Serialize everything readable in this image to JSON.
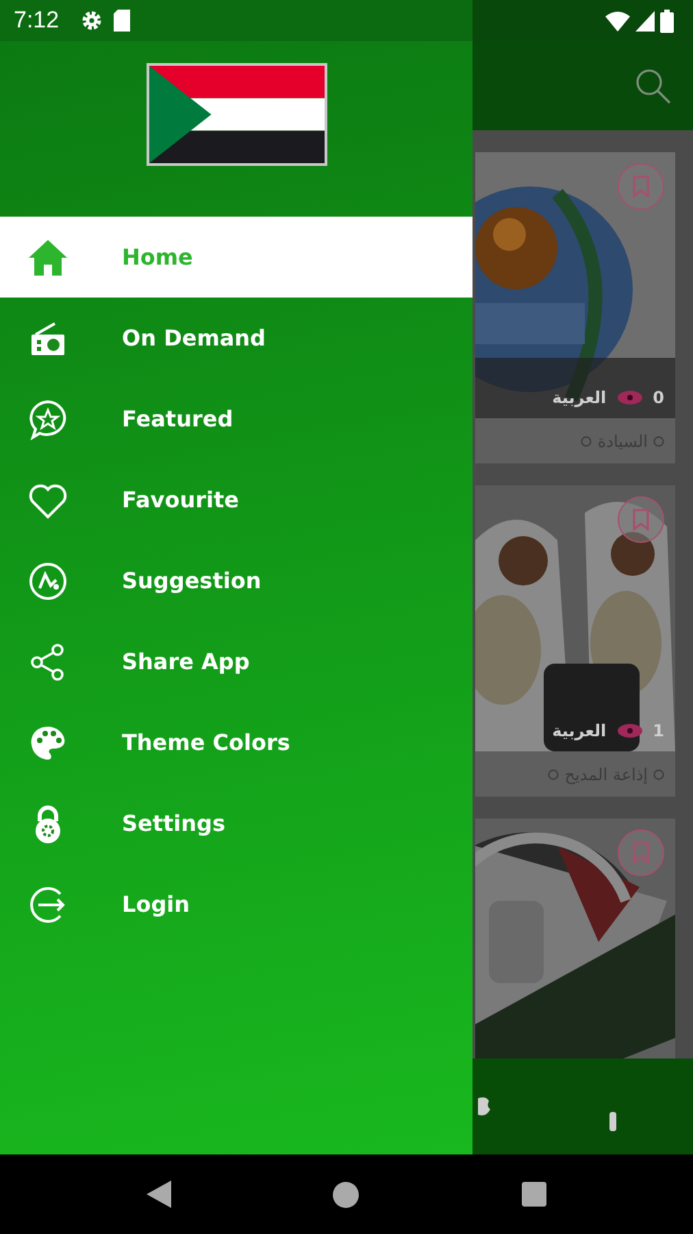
{
  "status_bar": {
    "time": "7:12"
  },
  "drawer": {
    "items": [
      {
        "label": "Home",
        "selected": true
      },
      {
        "label": "On Demand",
        "selected": false
      },
      {
        "label": "Featured",
        "selected": false
      },
      {
        "label": "Favourite",
        "selected": false
      },
      {
        "label": "Suggestion",
        "selected": false
      },
      {
        "label": "Share App",
        "selected": false
      },
      {
        "label": "Theme Colors",
        "selected": false
      },
      {
        "label": "Settings",
        "selected": false
      },
      {
        "label": "Login",
        "selected": false
      }
    ]
  },
  "stations": [
    {
      "kind": "picture",
      "count": "0",
      "language": "العربية",
      "name": "السيادة"
    },
    {
      "kind": "picture",
      "count": "1",
      "language": "العربية",
      "name": "إذاعة المديح"
    },
    {
      "kind": "picture"
    }
  ]
}
